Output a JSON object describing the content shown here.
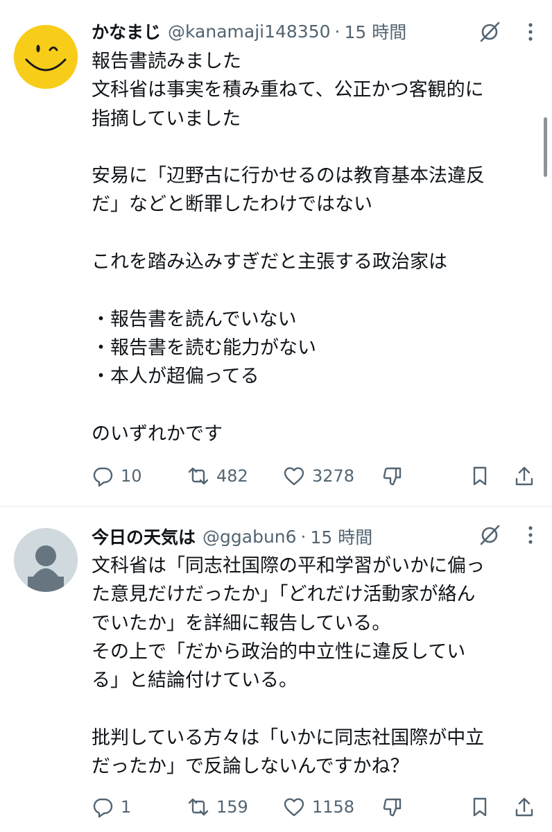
{
  "posts": [
    {
      "display_name": "かなまじ",
      "handle": "@kanamaji148350",
      "separator": "·",
      "time": "15 時間",
      "text": "報告書読みました\n文科省は事実を積み重ねて、公正かつ客観的に\n指摘していました\n\n安易に「辺野古に行かせるのは教育基本法違反\nだ」などと断罪したわけではない\n\nこれを踏み込みすぎだと主張する政治家は\n\n・報告書を読んでいない\n・報告書を読む能力がない\n・本人が超偏ってる\n\nのいずれかです",
      "replies": "10",
      "reposts": "482",
      "likes": "3278",
      "avatar_icon": "smiley-wink-avatar"
    },
    {
      "display_name": "今日の天気は",
      "handle": "@ggabun6",
      "separator": "·",
      "time": "15 時間",
      "text": "文科省は「同志社国際の平和学習がいかに偏っ\nた意見だけだったか」「どれだけ活動家が絡ん\nでいたか」を詳細に報告している。\nその上で「だから政治的中立性に違反してい\nる」と結論付けている。\n\n批判している方々は「いかに同志社国際が中立\nだったか」で反論しないんですかね？",
      "replies": "1",
      "reposts": "159",
      "likes": "1158",
      "avatar_icon": "default-person-avatar"
    }
  ],
  "colors": {
    "text": "#0f1419",
    "secondary": "#536471",
    "avatar_yellow": "#f7cd1a",
    "avatar_gray": "#cfd9de",
    "divider": "#eff3f4"
  },
  "icons": [
    "grok-icon",
    "more-icon",
    "reply-icon",
    "retweet-icon",
    "like-icon",
    "dislike-icon",
    "bookmark-icon",
    "share-icon"
  ]
}
